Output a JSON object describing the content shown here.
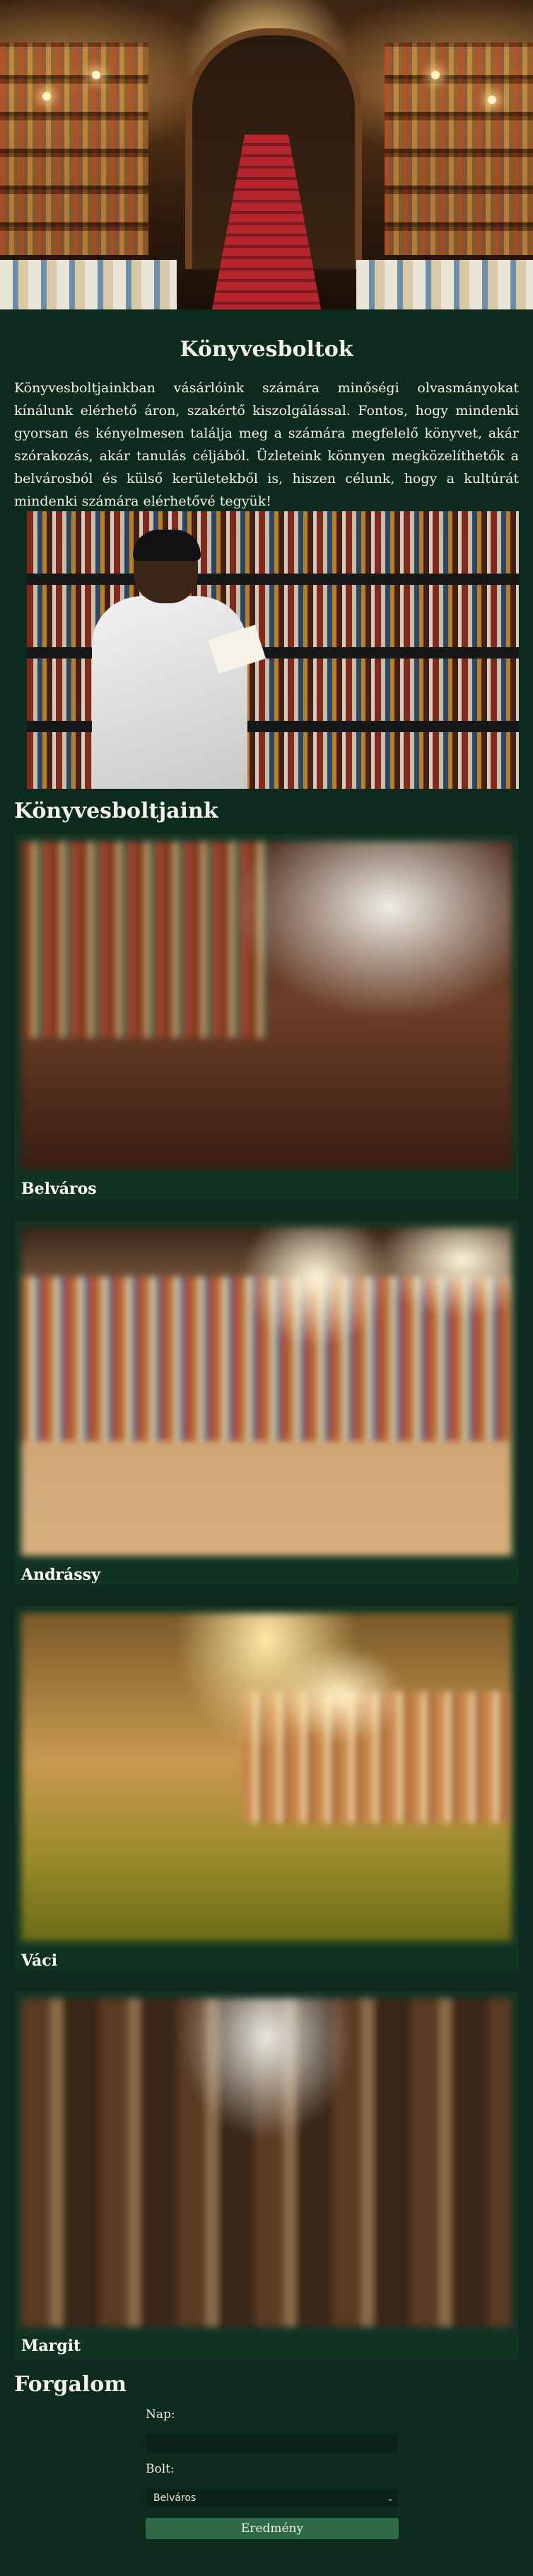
{
  "page": {
    "title": "Könyvesboltok",
    "intro": "Könyvesboltjainkban vásárlóink számára minőségi olvasmányokat kínálunk elérhető áron, szakértő kiszolgálással. Fontos, hogy mindenki gyorsan és kényelmesen találja meg a számára megfelelő könyvet, akár szórakozás, akár tanulás céljából. Üzleteink könnyen megközelíthetők a belvárosból és külső kerületekből is, hiszen célunk, hogy a kultúrát mindenki számára elérhetővé tegyük!"
  },
  "stores": {
    "title": "Könyvesboltjaink",
    "items": [
      {
        "name": "Belváros"
      },
      {
        "name": "Andrássy"
      },
      {
        "name": "Váci"
      },
      {
        "name": "Margit"
      }
    ]
  },
  "traffic_form": {
    "title": "Forgalom",
    "day_label": "Nap:",
    "day_value": "",
    "store_label": "Bolt:",
    "store_selected": "Belváros",
    "submit_label": "Eredmény"
  },
  "icons": {
    "select_arrow": "chevron-down-icon"
  },
  "colors": {
    "background": "#0d2a1e",
    "card": "#123324",
    "button": "#2e6a46"
  }
}
